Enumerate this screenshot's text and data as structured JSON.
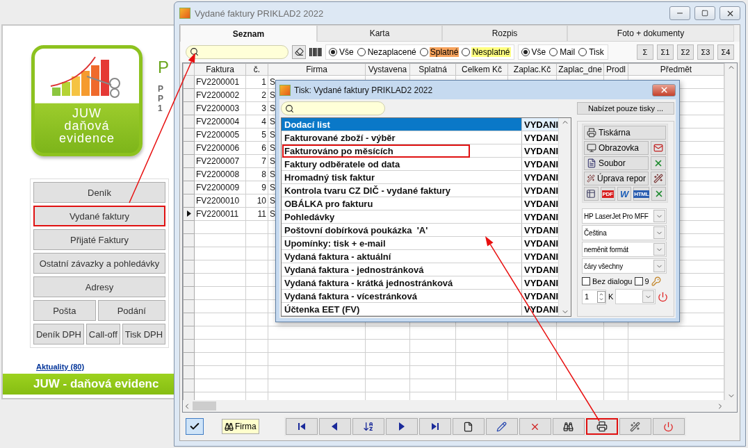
{
  "background_app": {
    "logo": [
      "JUW",
      "daňová",
      "evidence"
    ],
    "heading": "P",
    "info_lines": [
      "P",
      "P",
      "1"
    ],
    "menu": [
      [
        {
          "label": "Deník",
          "highlighted": false
        }
      ],
      [
        {
          "label": "Vydané faktury",
          "highlighted": true
        }
      ],
      [
        {
          "label": "Přijaté Faktury",
          "highlighted": false
        }
      ],
      [
        {
          "label": "Ostatní závazky a pohledávky",
          "highlighted": false
        }
      ],
      [
        {
          "label": "Adresy",
          "highlighted": false
        }
      ],
      [
        {
          "label": "Pošta",
          "highlighted": false
        },
        {
          "label": "Podání",
          "highlighted": false
        }
      ],
      [
        {
          "label": "Deník DPH",
          "highlighted": false
        },
        {
          "label": "Call-off",
          "highlighted": false
        },
        {
          "label": "Tisk DPH",
          "highlighted": false
        }
      ]
    ],
    "news_link": "Aktuality (80)",
    "banner": "JUW - daňová evidenc"
  },
  "main_window": {
    "title": "Vydané faktury PRIKLAD2 2022",
    "tabs": [
      {
        "label": "Seznam",
        "selected": true
      },
      {
        "label": "Karta",
        "selected": false
      },
      {
        "label": "Rozpis",
        "selected": false
      },
      {
        "label": "Foto + dokumenty",
        "selected": false
      }
    ],
    "status_filter": [
      {
        "label": "Vše",
        "selected": true
      },
      {
        "label": "Nezaplacené",
        "selected": false
      },
      {
        "label": "Splatné",
        "selected": false,
        "color": "#f7a35c"
      },
      {
        "label": "Nesplatné",
        "selected": false,
        "color": "#ffff80"
      }
    ],
    "send_filter": [
      {
        "label": "Vše",
        "selected": true
      },
      {
        "label": "Mail",
        "selected": false
      },
      {
        "label": "Tisk",
        "selected": false
      }
    ],
    "sum_buttons": [
      "Σ",
      "Σ1",
      "Σ2",
      "Σ3",
      "Σ4"
    ],
    "columns": [
      "Faktura",
      "č.",
      "Firma",
      "Vystavena",
      "Splatná",
      "Celkem Kč",
      "Zaplac.Kč",
      "Zaplac_dne",
      "Prodl",
      "Předmět"
    ],
    "rows": [
      {
        "cells": [
          "FV2200001",
          "1",
          "S"
        ],
        "current": false
      },
      {
        "cells": [
          "FV2200002",
          "2",
          "S"
        ],
        "current": false
      },
      {
        "cells": [
          "FV2200003",
          "3",
          "S"
        ],
        "current": false
      },
      {
        "cells": [
          "FV2200004",
          "4",
          "S"
        ],
        "current": false
      },
      {
        "cells": [
          "FV2200005",
          "5",
          "S"
        ],
        "current": false
      },
      {
        "cells": [
          "FV2200006",
          "6",
          "S"
        ],
        "current": false
      },
      {
        "cells": [
          "FV2200007",
          "7",
          "S"
        ],
        "current": false
      },
      {
        "cells": [
          "FV2200008",
          "8",
          "S"
        ],
        "current": false
      },
      {
        "cells": [
          "FV2200009",
          "9",
          "S"
        ],
        "current": false
      },
      {
        "cells": [
          "FV2200010",
          "10",
          "S"
        ],
        "current": false
      },
      {
        "cells": [
          "FV2200011",
          "11",
          "S"
        ],
        "current": true
      }
    ],
    "firm_button": "Firma",
    "nav_buttons": [
      {
        "kind": "first",
        "highlighted": false
      },
      {
        "kind": "prev",
        "highlighted": false
      },
      {
        "kind": "sort",
        "highlighted": false
      },
      {
        "kind": "next",
        "highlighted": false
      },
      {
        "kind": "last",
        "highlighted": false
      },
      {
        "kind": "new",
        "highlighted": false
      },
      {
        "kind": "edit",
        "highlighted": false
      },
      {
        "kind": "delete",
        "highlighted": false
      },
      {
        "kind": "find",
        "highlighted": false
      },
      {
        "kind": "print",
        "highlighted": true
      },
      {
        "kind": "design",
        "highlighted": false
      },
      {
        "kind": "power",
        "highlighted": false
      }
    ]
  },
  "print_dialog": {
    "title": "Tisk: Vydané faktury PRIKLAD2 2022",
    "offer_button": "Nabízet pouze tisky ...",
    "reports": [
      {
        "name": "Dodací list",
        "type": "VYDANI",
        "selected": true,
        "highlighted": false
      },
      {
        "name": "Fakturované zboží - výběr",
        "type": "VYDANI",
        "selected": false,
        "highlighted": false
      },
      {
        "name": "Fakturováno po měsících",
        "type": "VYDANI",
        "selected": false,
        "highlighted": true
      },
      {
        "name": "Faktury odběratele od data",
        "type": "VYDANI",
        "selected": false,
        "highlighted": false
      },
      {
        "name": "Hromadný tisk faktur",
        "type": "VYDANI",
        "selected": false,
        "highlighted": false
      },
      {
        "name": "Kontrola tvaru CZ DIČ - vydané faktury",
        "type": "VYDANI",
        "selected": false,
        "highlighted": false
      },
      {
        "name": "OBÁLKA pro fakturu",
        "type": "VYDANI",
        "selected": false,
        "highlighted": false
      },
      {
        "name": "Pohledávky",
        "type": "VYDANI",
        "selected": false,
        "highlighted": false
      },
      {
        "name": "Poštovní dobírková poukázka  'A'",
        "type": "VYDANI",
        "selected": false,
        "highlighted": false
      },
      {
        "name": "Upomínky: tisk + e-mail",
        "type": "VYDANI",
        "selected": false,
        "highlighted": false
      },
      {
        "name": "Vydaná faktura - aktuální",
        "type": "VYDANI",
        "selected": false,
        "highlighted": false
      },
      {
        "name": "Vydaná faktura - jednostránková",
        "type": "VYDANI",
        "selected": false,
        "highlighted": false
      },
      {
        "name": "Vydaná faktura - krátká jednostránková",
        "type": "VYDANI",
        "selected": false,
        "highlighted": false
      },
      {
        "name": "Vydaná faktura - vícestránková",
        "type": "VYDANI",
        "selected": false,
        "highlighted": false
      },
      {
        "name": "Účtenka EET (FV)",
        "type": "VYDANI",
        "selected": false,
        "highlighted": false
      }
    ],
    "outputs": [
      {
        "label": "Tiskárna",
        "kind": "printer"
      },
      {
        "label": "Obrazovka",
        "kind": "screen",
        "side": {
          "kind": "email"
        }
      },
      {
        "label": "Soubor",
        "kind": "file",
        "side": {
          "kind": "excel"
        }
      },
      {
        "label": "Úprava repor",
        "kind": "design",
        "side": {
          "kind": "design"
        }
      }
    ],
    "formats": [
      {
        "kind": "grid"
      },
      {
        "kind": "pdf",
        "label": "PDF"
      },
      {
        "kind": "word",
        "label": "W"
      },
      {
        "kind": "html",
        "label": "HTML"
      },
      {
        "kind": "excel"
      }
    ],
    "selects": [
      "HP LaserJet Pro MFF",
      "Čeština",
      "neměnit formát",
      "čáry všechny"
    ],
    "checkboxes": [
      {
        "label": "Bez dialogu",
        "checked": false
      },
      {
        "label": "9",
        "checked": false
      }
    ],
    "copies": "1",
    "copies_label": "K"
  }
}
